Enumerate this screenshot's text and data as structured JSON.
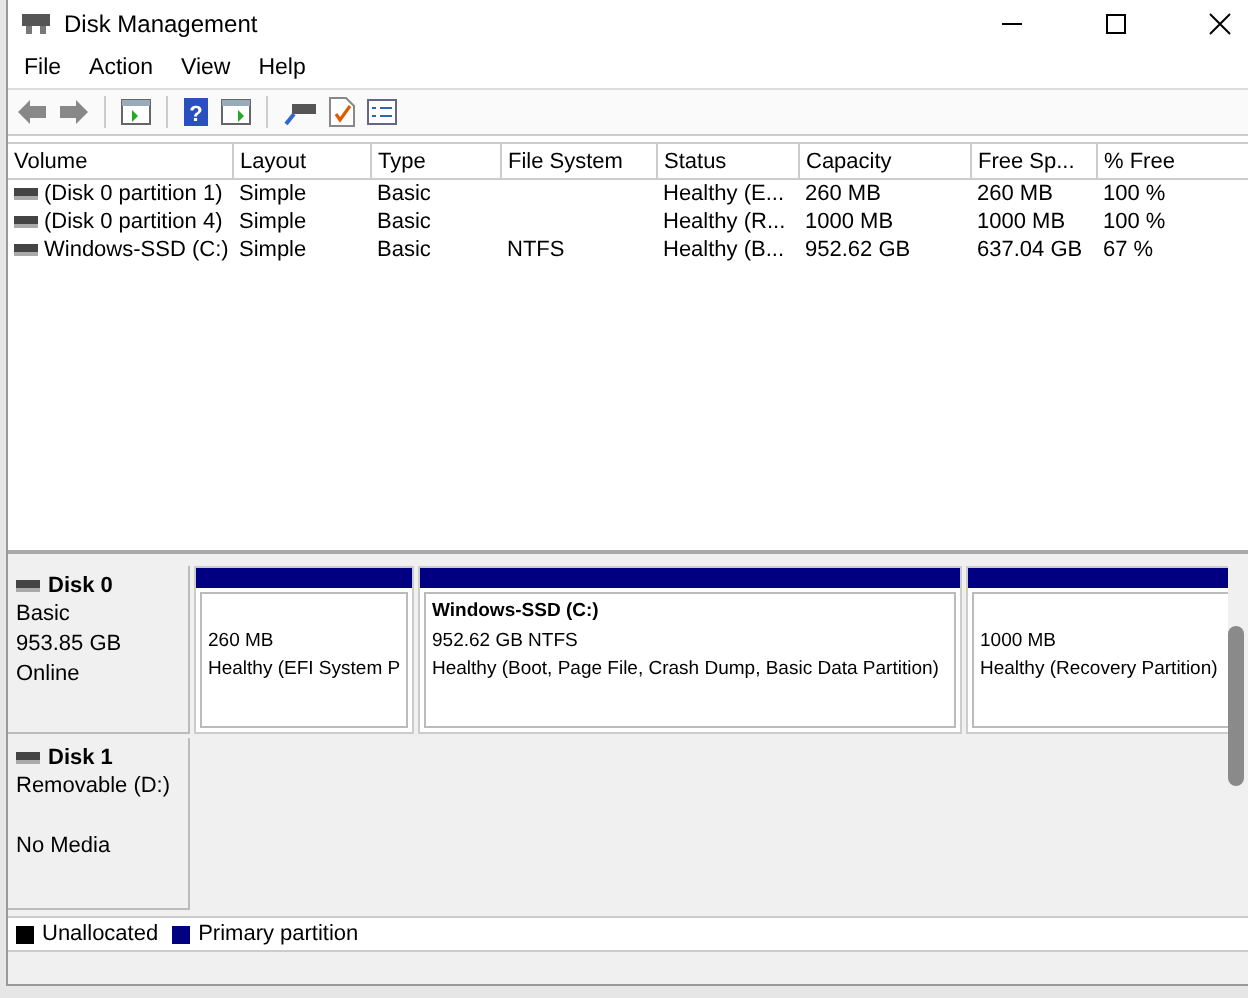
{
  "window": {
    "title": "Disk Management"
  },
  "menu": [
    "File",
    "Action",
    "View",
    "Help"
  ],
  "toolbar": {
    "help_icon": "?"
  },
  "table": {
    "columns": [
      "Volume",
      "Layout",
      "Type",
      "File System",
      "Status",
      "Capacity",
      "Free Sp...",
      "% Free"
    ],
    "rows": [
      {
        "cells": [
          "(Disk 0 partition 1)",
          "Simple",
          "Basic",
          "",
          "Healthy (E...",
          "260 MB",
          "260 MB",
          "100 %"
        ]
      },
      {
        "cells": [
          "(Disk 0 partition 4)",
          "Simple",
          "Basic",
          "",
          "Healthy (R...",
          "1000 MB",
          "1000 MB",
          "100 %"
        ]
      },
      {
        "cells": [
          "Windows-SSD (C:)",
          "Simple",
          "Basic",
          "NTFS",
          "Healthy (B...",
          "952.62 GB",
          "637.04 GB",
          "67 %"
        ]
      }
    ]
  },
  "disks": [
    {
      "name": "Disk 0",
      "lines": [
        "Basic",
        "953.85 GB"
      ],
      "status": "Online",
      "partitions": [
        {
          "kind": "primary",
          "lines": [
            "260 MB",
            "Healthy (EFI System P"
          ]
        },
        {
          "kind": "primary",
          "title": "Windows-SSD  (C:)",
          "lines": [
            "952.62 GB NTFS",
            "Healthy (Boot, Page File, Crash Dump, Basic Data Partition)"
          ]
        },
        {
          "kind": "primary",
          "lines": [
            "1000 MB",
            "Healthy (Recovery Partition)"
          ]
        }
      ]
    },
    {
      "name": "Disk 1",
      "lines": [
        "Removable (D:)"
      ],
      "status": "No Media"
    }
  ],
  "legend": [
    {
      "label": "Unallocated",
      "color": "#000000"
    },
    {
      "label": "Primary partition",
      "color": "#000080"
    }
  ]
}
